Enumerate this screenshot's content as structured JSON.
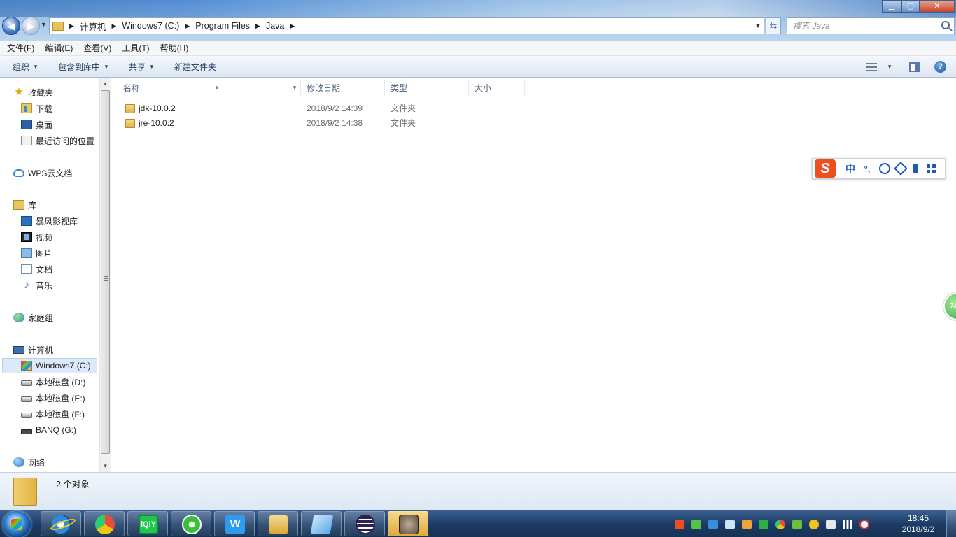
{
  "window": {
    "minimize_icon": "minimize-icon",
    "maximize_icon": "maximize-icon",
    "close_icon": "close-icon"
  },
  "address": {
    "crumbs": [
      "计算机",
      "Windows7 (C:)",
      "Program Files",
      "Java"
    ],
    "search_placeholder": "搜索 Java"
  },
  "menu": [
    "文件(F)",
    "编辑(E)",
    "查看(V)",
    "工具(T)",
    "帮助(H)"
  ],
  "commands": {
    "organize": "组织",
    "include_in_library": "包含到库中",
    "share": "共享",
    "new_folder": "新建文件夹"
  },
  "nav": {
    "favorites": "收藏夹",
    "downloads": "下载",
    "desktop": "桌面",
    "recent": "最近访问的位置",
    "wps": "WPS云文档",
    "libraries": "库",
    "baofeng": "暴风影视库",
    "videos": "视频",
    "pictures": "图片",
    "documents": "文档",
    "music": "音乐",
    "homegroup": "家庭组",
    "computer": "计算机",
    "drive_c": "Windows7 (C:)",
    "drive_d": "本地磁盘 (D:)",
    "drive_e": "本地磁盘 (E:)",
    "drive_f": "本地磁盘 (F:)",
    "drive_g": "BANQ (G:)",
    "network": "网络"
  },
  "columns": {
    "name": "名称",
    "date": "修改日期",
    "type": "类型",
    "size": "大小"
  },
  "files": [
    {
      "name": "jdk-10.0.2",
      "date": "2018/9/2 14:39",
      "type": "文件夹"
    },
    {
      "name": "jre-10.0.2",
      "date": "2018/9/2 14:38",
      "type": "文件夹"
    }
  ],
  "ime": {
    "logo": "S",
    "mode": "中",
    "punct": "°,"
  },
  "edge_badge": "74",
  "details": {
    "count": "2 个对象"
  },
  "taskbar": {
    "iqiyi_label": "iQIY",
    "wps_label": "W",
    "time": "18:45",
    "date": "2018/9/2"
  }
}
